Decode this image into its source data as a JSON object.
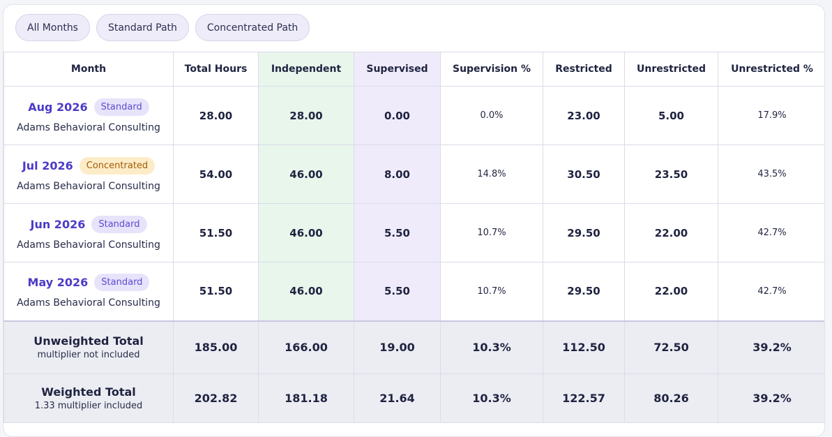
{
  "filters": [
    "All Months",
    "Standard Path",
    "Concentrated Path"
  ],
  "columns": [
    "Month",
    "Total Hours",
    "Independent",
    "Supervised",
    "Supervision %",
    "Restricted",
    "Unrestricted",
    "Unrestricted %"
  ],
  "rows": [
    {
      "month": "Aug 2026",
      "badge": "Standard",
      "company": "Adams Behavioral Consulting",
      "total": "28.00",
      "independent": "28.00",
      "supervised": "0.00",
      "supervision_pct": "0.0%",
      "restricted": "23.00",
      "unrestricted": "5.00",
      "unrestricted_pct": "17.9%"
    },
    {
      "month": "Jul 2026",
      "badge": "Concentrated",
      "company": "Adams Behavioral Consulting",
      "total": "54.00",
      "independent": "46.00",
      "supervised": "8.00",
      "supervision_pct": "14.8%",
      "restricted": "30.50",
      "unrestricted": "23.50",
      "unrestricted_pct": "43.5%"
    },
    {
      "month": "Jun 2026",
      "badge": "Standard",
      "company": "Adams Behavioral Consulting",
      "total": "51.50",
      "independent": "46.00",
      "supervised": "5.50",
      "supervision_pct": "10.7%",
      "restricted": "29.50",
      "unrestricted": "22.00",
      "unrestricted_pct": "42.7%"
    },
    {
      "month": "May 2026",
      "badge": "Standard",
      "company": "Adams Behavioral Consulting",
      "total": "51.50",
      "independent": "46.00",
      "supervised": "5.50",
      "supervision_pct": "10.7%",
      "restricted": "29.50",
      "unrestricted": "22.00",
      "unrestricted_pct": "42.7%"
    }
  ],
  "totals": [
    {
      "label": "Unweighted Total",
      "sub": "multiplier not included",
      "total": "185.00",
      "independent": "166.00",
      "supervised": "19.00",
      "supervision_pct": "10.3%",
      "restricted": "112.50",
      "unrestricted": "72.50",
      "unrestricted_pct": "39.2%"
    },
    {
      "label": "Weighted Total",
      "sub": "1.33 multiplier included",
      "total": "202.82",
      "independent": "181.18",
      "supervised": "21.64",
      "supervision_pct": "10.3%",
      "restricted": "122.57",
      "unrestricted": "80.26",
      "unrestricted_pct": "39.2%"
    }
  ],
  "colors": {
    "indep_bg": "#e8f6ec",
    "superv_bg": "#efebfb",
    "month_text": "#4b3bc7",
    "standard_badge_bg": "#e7e3fb",
    "concentrated_badge_bg": "#fdecc8"
  }
}
